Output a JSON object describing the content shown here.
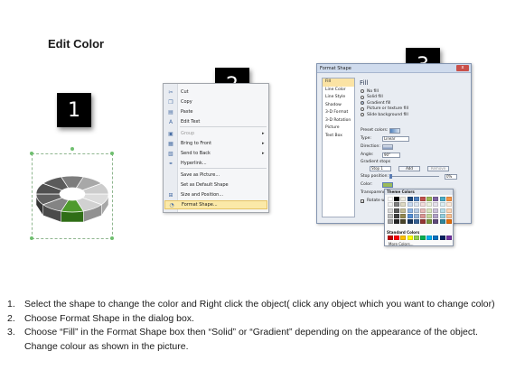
{
  "title": "Edit Color",
  "steps": [
    "1",
    "2",
    "3"
  ],
  "context_menu": {
    "items": [
      {
        "label": "Cut",
        "icon": "scissors-icon",
        "glyph": "✂"
      },
      {
        "label": "Copy",
        "icon": "copy-icon",
        "glyph": "❐"
      },
      {
        "label": "Paste",
        "icon": "paste-icon",
        "glyph": "▤"
      },
      {
        "label": "Edit Text",
        "icon": "edit-text-icon",
        "glyph": "A"
      },
      {
        "label": "Group",
        "icon": "group-icon",
        "glyph": "▣",
        "disabled": true,
        "submenu": true
      },
      {
        "label": "Bring to Front",
        "icon": "bring-front-icon",
        "glyph": "▦",
        "submenu": true
      },
      {
        "label": "Send to Back",
        "icon": "send-back-icon",
        "glyph": "▧",
        "submenu": true
      },
      {
        "label": "Hyperlink...",
        "icon": "hyperlink-icon",
        "glyph": "⚭"
      },
      {
        "label": "Save as Picture...",
        "icon": "",
        "glyph": ""
      },
      {
        "label": "Set as Default Shape",
        "icon": "",
        "glyph": ""
      },
      {
        "label": "Size and Position...",
        "icon": "size-position-icon",
        "glyph": "⊞"
      },
      {
        "label": "Format Shape...",
        "icon": "format-shape-icon",
        "glyph": "◔",
        "highlight": true
      }
    ]
  },
  "format_dialog": {
    "title": "Format Shape",
    "close": "x",
    "nav": [
      "Fill",
      "Line Color",
      "Line Style",
      "Shadow",
      "3-D Format",
      "3-D Rotation",
      "Picture",
      "Text Box"
    ],
    "fill_heading": "Fill",
    "fill_options": [
      "No fill",
      "Solid fill",
      "Gradient fill",
      "Picture or texture fill",
      "Slide background fill"
    ],
    "selected_fill": "Gradient fill",
    "preset_label": "Preset colors:",
    "type_label": "Type:",
    "type_value": "Linear",
    "direction_label": "Direction:",
    "angle_label": "Angle:",
    "angle_value": "90°",
    "gradient_stops_label": "Gradient stops",
    "stop_value": "Stop 1",
    "add_label": "Add",
    "remove_label": "Remove",
    "stop_position_label": "Stop position:",
    "stop_position_value": "0%",
    "color_label": "Color:",
    "transparency_label": "Transparency:",
    "rotate_label": "Rotate with shape"
  },
  "palette": {
    "theme_header": "Theme Colors",
    "standard_header": "Standard Colors",
    "more_label": "More Colors...",
    "theme_colors": [
      [
        "#ffffff",
        "#000000",
        "#eeece1",
        "#1f497d",
        "#4f81bd",
        "#c0504d",
        "#9bbb59",
        "#8064a2",
        "#4bacc6",
        "#f79646"
      ],
      [
        "#f2f2f2",
        "#7f7f7f",
        "#ddd9c3",
        "#c6d9f0",
        "#dbe5f1",
        "#f2dcdb",
        "#ebf1dd",
        "#e5e0ec",
        "#dbeef3",
        "#fdeada"
      ],
      [
        "#d8d8d8",
        "#595959",
        "#c4bd97",
        "#8db3e2",
        "#b8cce4",
        "#e5b9b7",
        "#d7e3bc",
        "#ccc1d9",
        "#b7dde8",
        "#fbd5b5"
      ],
      [
        "#bfbfbf",
        "#3f3f3f",
        "#938953",
        "#548dd4",
        "#95b3d7",
        "#d99694",
        "#c3d69b",
        "#b2a2c7",
        "#92cddc",
        "#fac08f"
      ],
      [
        "#a5a5a5",
        "#262626",
        "#494429",
        "#17365d",
        "#366092",
        "#953734",
        "#76923c",
        "#5f497a",
        "#31859b",
        "#e36c09"
      ]
    ],
    "standard_colors": [
      "#c00000",
      "#ff0000",
      "#ffc000",
      "#ffff00",
      "#92d050",
      "#00b050",
      "#00b0f0",
      "#0070c0",
      "#002060",
      "#7030a0"
    ]
  },
  "pie": {
    "highlight_color": "#4e9a2c",
    "base_color": "#a8a8a8",
    "segments": 10
  },
  "instructions": [
    {
      "num": "1.",
      "text": "Select the shape to change the color and Right click the object( click any object which you want to change color)"
    },
    {
      "num": "2.",
      "text": "Choose Format Shape in the dialog box."
    },
    {
      "num": "3.",
      "text": "Choose “Fill” in the Format Shape box then “Solid” or “Gradient” depending on the appearance of the object. Change colour as shown in the picture."
    }
  ]
}
